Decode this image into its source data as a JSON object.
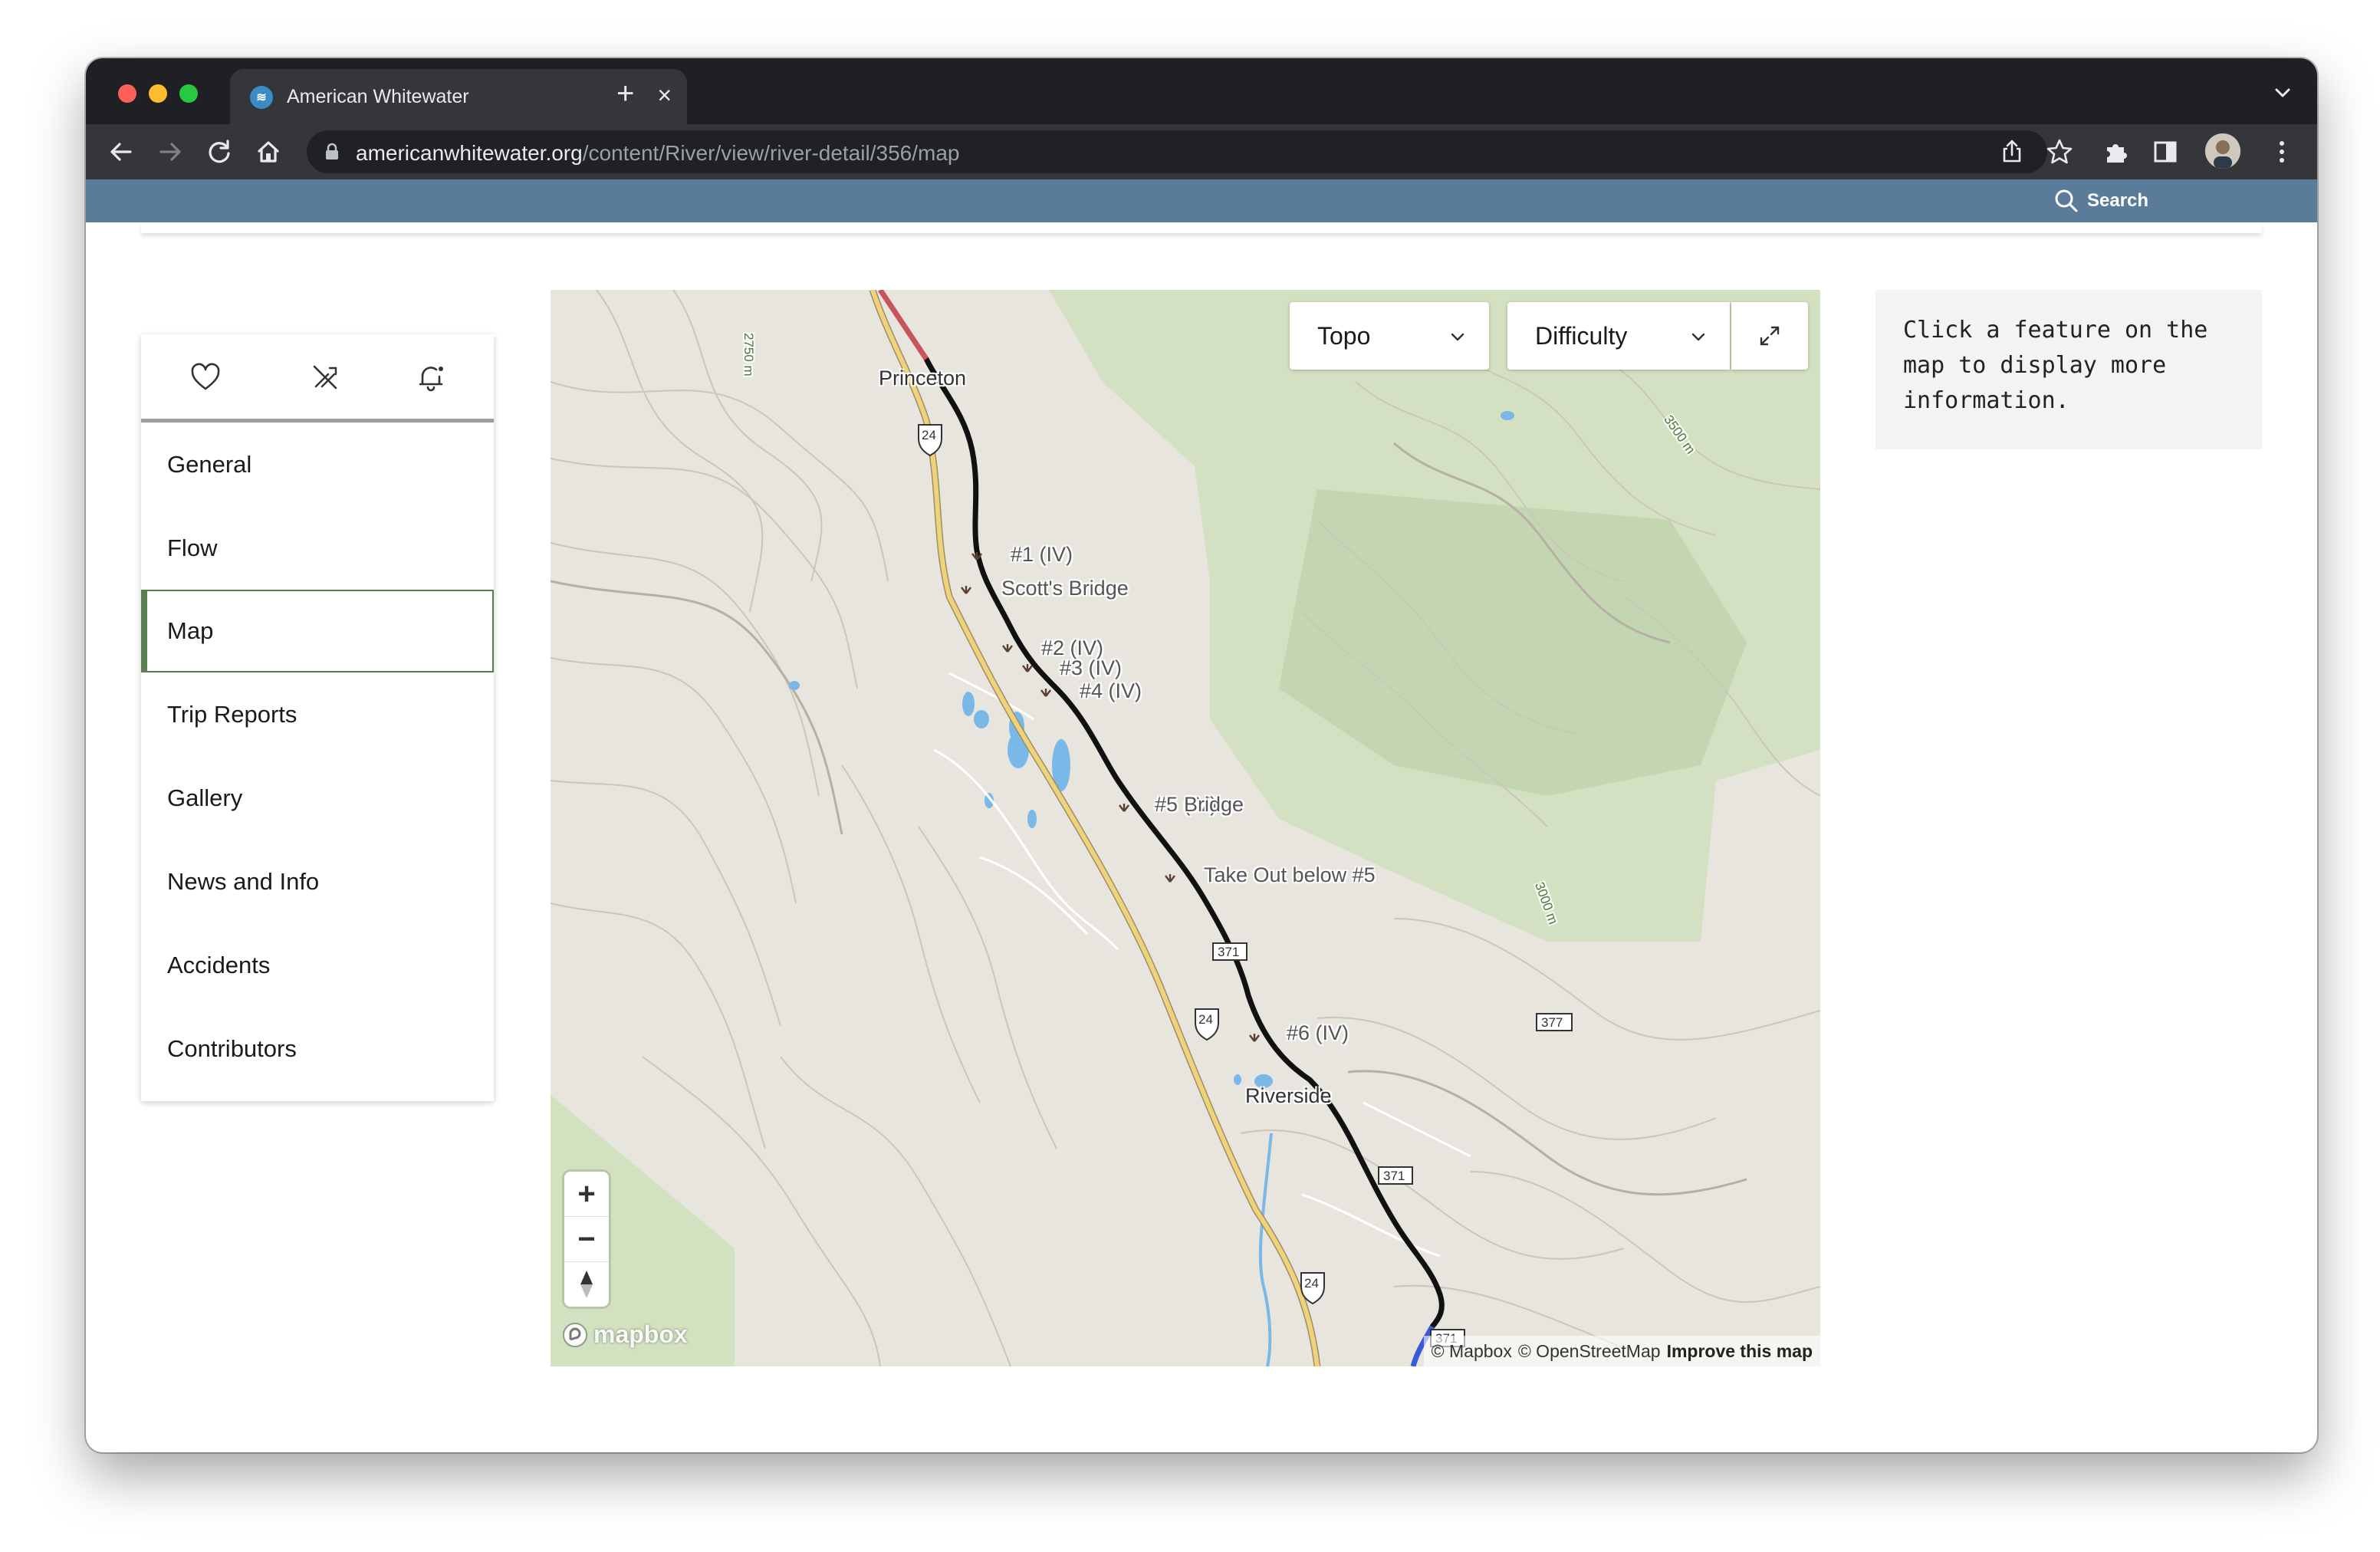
{
  "browser": {
    "tab_title": "American Whitewater",
    "tab_close": "×",
    "new_tab": "+",
    "url_host": "americanwhitewater.org",
    "url_path": "/content/River/view/river-detail/356/map"
  },
  "site_header": {
    "search_label": "Search"
  },
  "sidebar": {
    "actions": [
      "heart-icon",
      "no-boating-icon",
      "bell-add-icon"
    ],
    "items": [
      {
        "label": "General"
      },
      {
        "label": "Flow"
      },
      {
        "label": "Map",
        "active": true
      },
      {
        "label": "Trip Reports"
      },
      {
        "label": "Gallery"
      },
      {
        "label": "News and Info"
      },
      {
        "label": "Accidents"
      },
      {
        "label": "Contributors"
      }
    ]
  },
  "map": {
    "layer_select": "Topo",
    "color_select": "Difficulty",
    "zoom_in": "+",
    "zoom_out": "−",
    "logo_text": "mapbox",
    "attribution": {
      "mapbox": "© Mapbox",
      "osm": "© OpenStreetMap",
      "improve": "Improve this map"
    },
    "places": {
      "town_north": "Princeton",
      "town_south": "Riverside"
    },
    "rapids": {
      "r1": "#1 (IV)",
      "scotts": "Scott's Bridge",
      "r2": "#2 (IV)",
      "r3": "#3 (IV)",
      "r4": "#4 (IV)",
      "r5": "#5 (IV)",
      "bridge": "Bridge",
      "takeout": "Take Out below #5",
      "r6": "#6 (IV)"
    },
    "contours": {
      "c1": "2750 m",
      "c2": "3500 m",
      "c3": "3000 m"
    },
    "shields": {
      "us24_a": "24",
      "us24_b": "24",
      "us24_c": "24",
      "co371_a": "371",
      "co371_b": "371",
      "co371_c": "371",
      "co377": "377"
    }
  },
  "info_panel": {
    "text": "Click a feature on the map to display more information."
  }
}
